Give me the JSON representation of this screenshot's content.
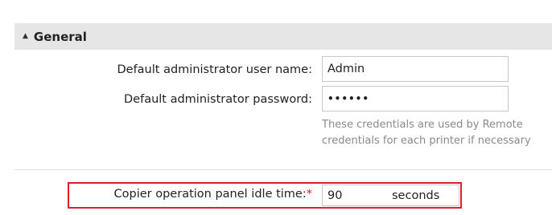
{
  "section": {
    "title": "General",
    "collapse_icon": "▲"
  },
  "fields": {
    "admin_username": {
      "label": "Default administrator user name:",
      "value": "Admin"
    },
    "admin_password": {
      "label": "Default administrator password:",
      "value": "••••••"
    },
    "help_text_line1": "These credentials are used by Remote",
    "help_text_line2": "credentials for each printer if necessary",
    "idle_time": {
      "label": "Copier operation panel idle time:",
      "required_marker": "*",
      "value": "90",
      "unit": "seconds"
    }
  },
  "colors": {
    "highlight": "#e11d25",
    "header_bg": "#e6e6e6",
    "help_text": "#8a8a8a"
  }
}
